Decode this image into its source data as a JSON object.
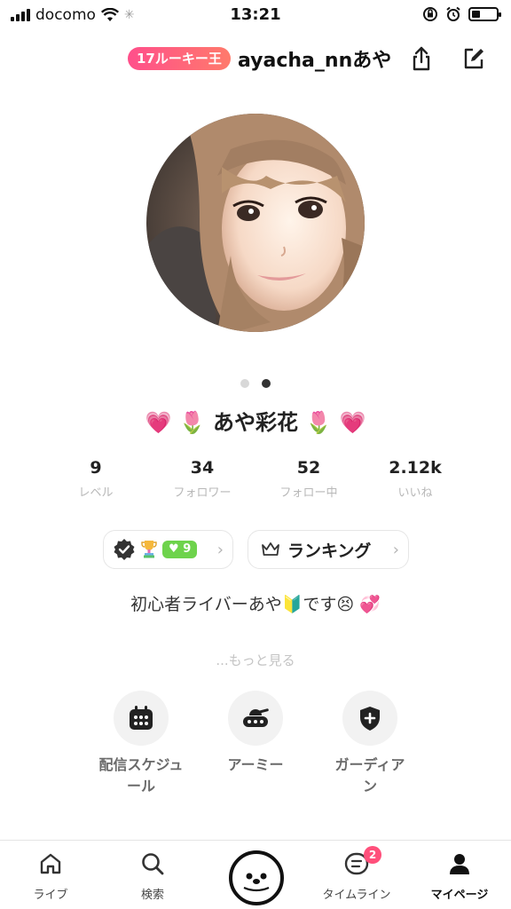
{
  "status_bar": {
    "carrier": "docomo",
    "time": "13:21",
    "battery_level": 0.35
  },
  "header": {
    "badge": "17ルーキー王",
    "username": "ayacha_nnあや"
  },
  "profile": {
    "display_name": "あや彩花",
    "name_emoji_left": "💗 🌷",
    "name_emoji_right": "🌷 💗",
    "carousel": {
      "pages": 2,
      "active": 2
    }
  },
  "stats": [
    {
      "value": "9",
      "label": "レベル"
    },
    {
      "value": "34",
      "label": "フォロワー"
    },
    {
      "value": "52",
      "label": "フォロー中"
    },
    {
      "value": "2.12k",
      "label": "いいね"
    }
  ],
  "chips": {
    "level_value": "9",
    "ranking_label": "ランキング"
  },
  "bio": "初心者ライバーあや🔰です😣 💞",
  "more_link": "...もっと見る",
  "actions": [
    {
      "label": "配信スケジュール",
      "icon": "calendar-icon"
    },
    {
      "label": "アーミー",
      "icon": "tank-icon"
    },
    {
      "label": "ガーディアン",
      "icon": "shield-icon"
    }
  ],
  "tabs": [
    {
      "label": "ライブ",
      "icon": "home-icon"
    },
    {
      "label": "検索",
      "icon": "search-icon"
    },
    {
      "label": "",
      "icon": "bot-face-icon"
    },
    {
      "label": "タイムライン",
      "icon": "timeline-icon",
      "badge": "2"
    },
    {
      "label": "マイページ",
      "icon": "person-icon",
      "active": true
    }
  ],
  "colors": {
    "badge_gradient": [
      "#ff4f8b",
      "#ff7a6b"
    ],
    "level_badge": "#6ed34c",
    "notification": "#ff4f7b"
  }
}
